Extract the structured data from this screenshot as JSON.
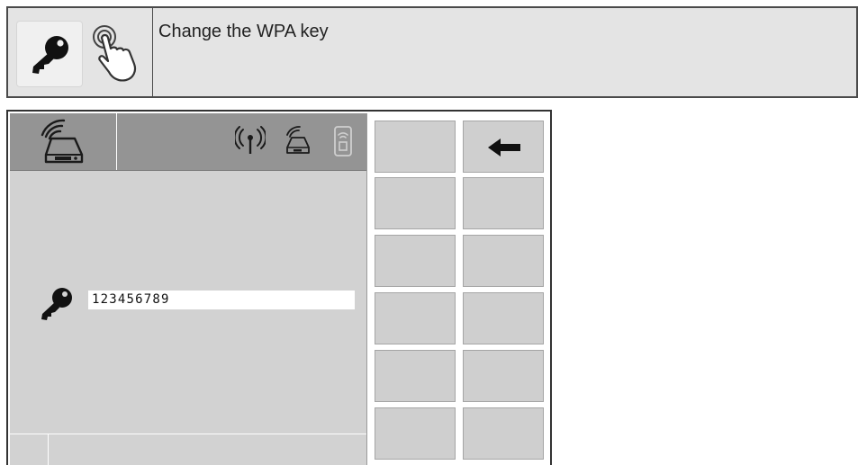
{
  "instruction": {
    "text": "Change the WPA key",
    "icons": [
      "key-icon",
      "tap-hand-icon"
    ]
  },
  "screen": {
    "statusbar_icons": [
      "modem-wifi-icon",
      "antenna-icon",
      "modem-small-icon",
      "phone-wifi-icon"
    ],
    "wpa_key": {
      "icon": "key-icon",
      "value": "123456789"
    },
    "softkeys": [
      {
        "id": "back",
        "icon": "arrow-left-icon"
      },
      {
        "id": "empty"
      },
      {
        "id": "empty"
      },
      {
        "id": "empty"
      },
      {
        "id": "empty"
      },
      {
        "id": "empty"
      },
      {
        "id": "empty"
      },
      {
        "id": "empty"
      },
      {
        "id": "empty"
      },
      {
        "id": "empty"
      },
      {
        "id": "empty"
      },
      {
        "id": "empty"
      }
    ]
  },
  "colors": {
    "header_bg": "#e4e4e4",
    "pane_bg": "#d2d2d2",
    "statusbar_bg": "#949494",
    "softkey_bg": "#cfcfcf"
  }
}
